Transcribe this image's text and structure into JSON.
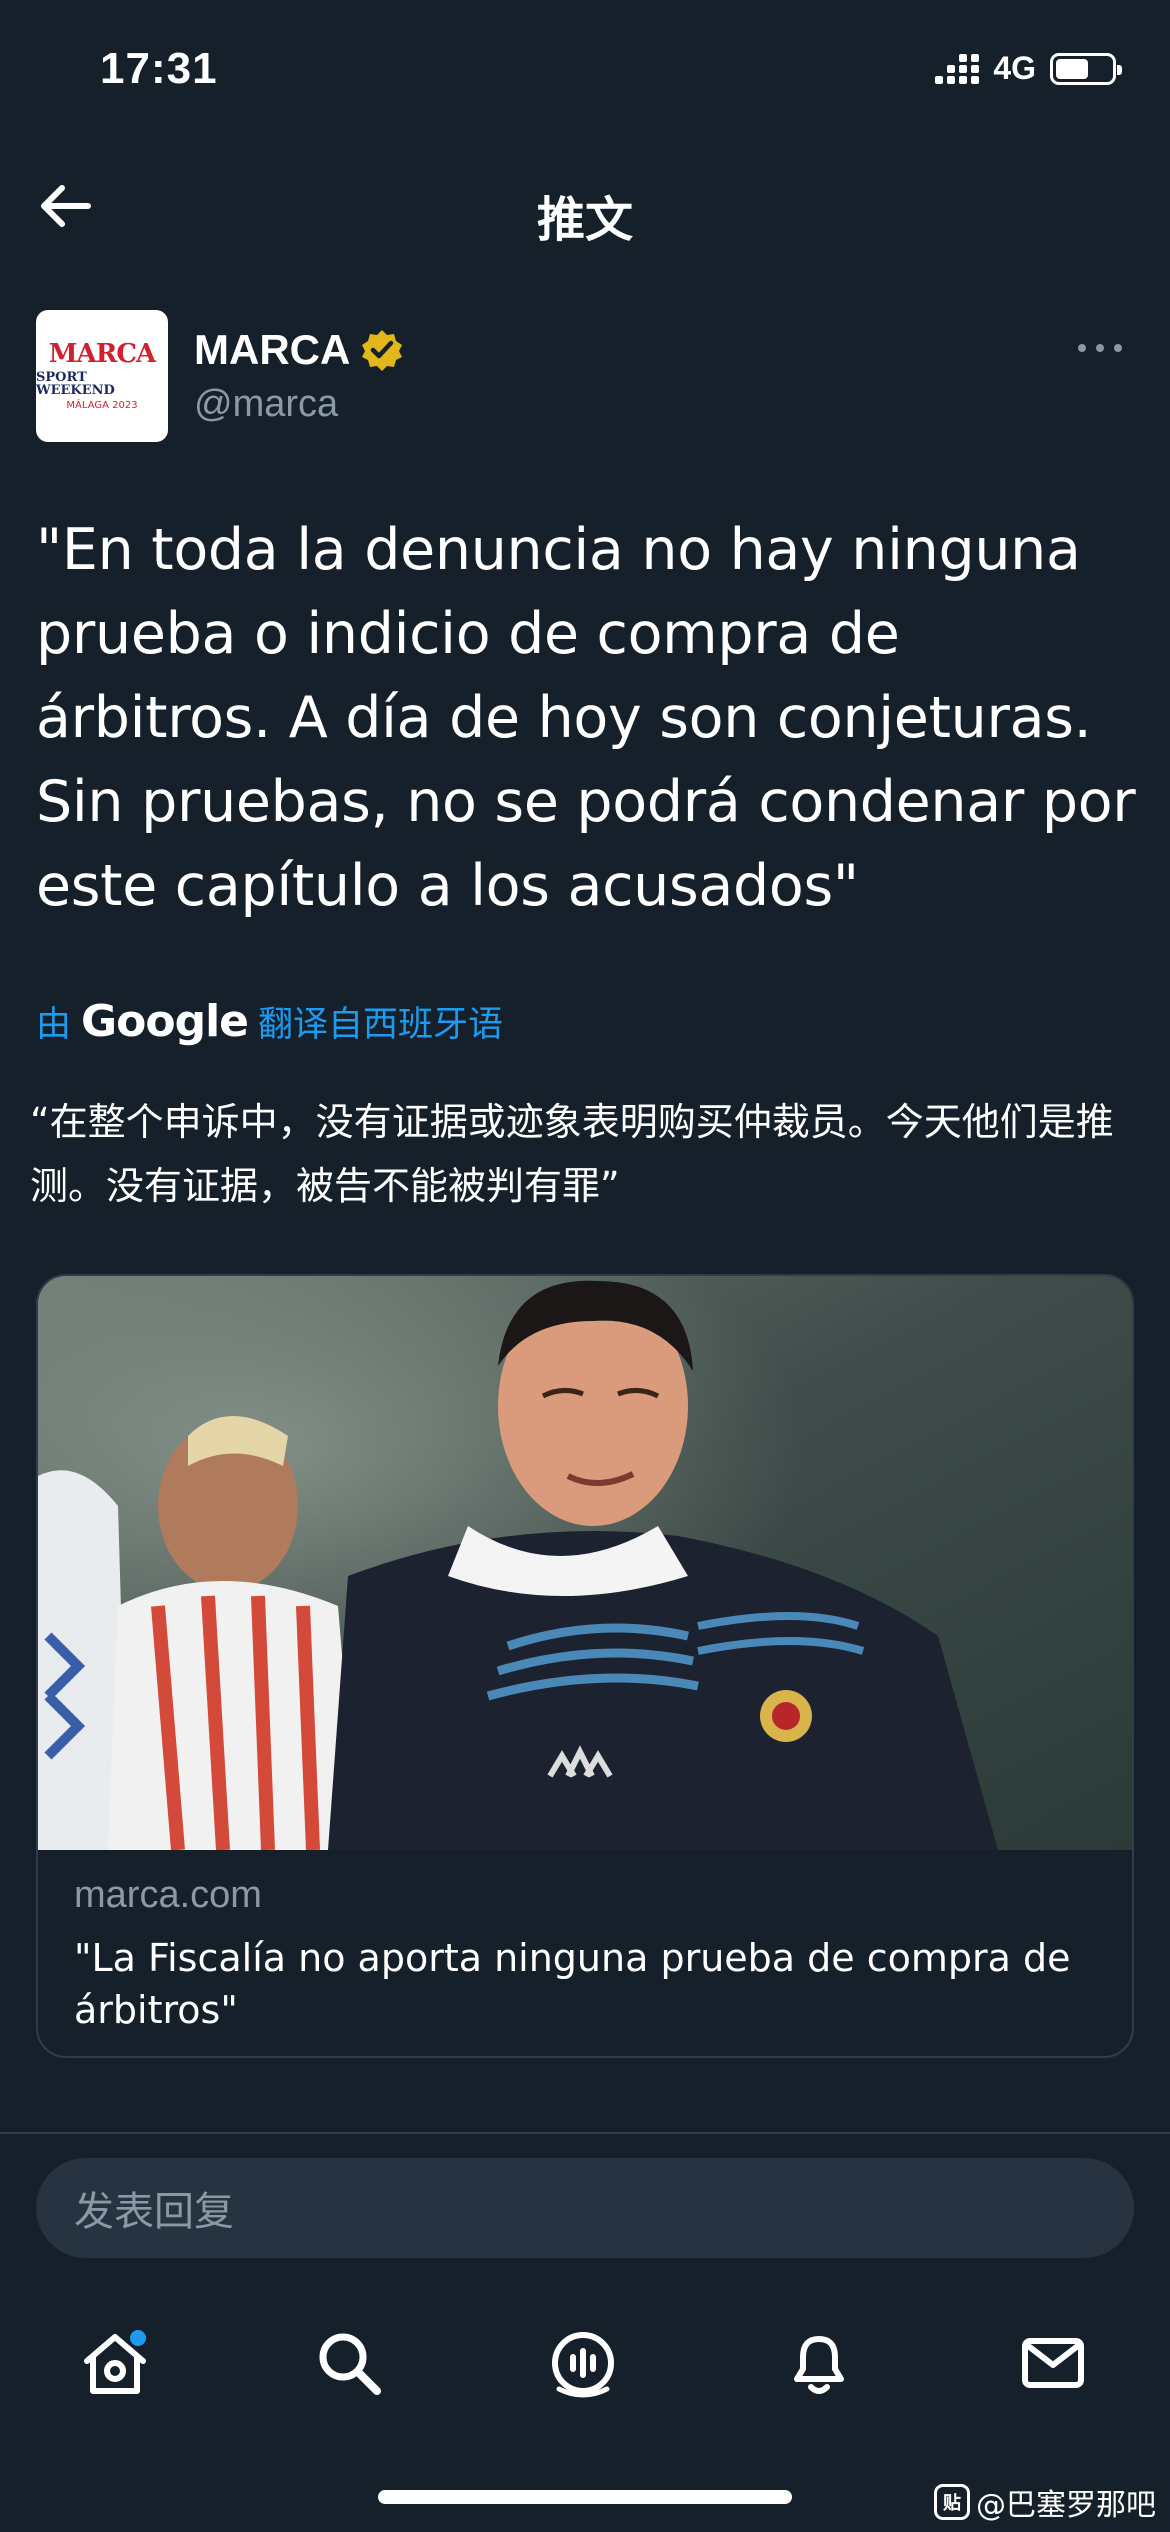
{
  "status_bar": {
    "time": "17:31",
    "network": "4G"
  },
  "header": {
    "title": "推文"
  },
  "tweet": {
    "author": {
      "name": "MARCA",
      "handle": "@marca",
      "avatar_lines": [
        "MARCA",
        "SPORT WEEKEND",
        "MÁLAGA 2023"
      ]
    },
    "text": "\"En toda la denuncia no hay ninguna prueba o indicio de compra de árbitros. A día de hoy son conjeturas. Sin pruebas, no se podrá condenar por este capítulo a los acusados\"",
    "translation": {
      "prefix": "由",
      "provider": "Google",
      "suffix": "翻译自西班牙语",
      "text": "“在整个申诉中，没有证据或迹象表明购买仲裁员。今天他们是推测。没有证据，被告不能被判有罪”"
    },
    "card": {
      "domain": "marca.com",
      "title": "\"La Fiscalía no aporta ninguna prueba de compra de árbitros\""
    }
  },
  "reply": {
    "placeholder": "发表回复"
  },
  "watermark": {
    "badge": "贴",
    "text": "@巴塞罗那吧"
  },
  "colors": {
    "background": "#15202b",
    "accent": "#1d9bf0",
    "muted": "#8b98a5",
    "verified": "#e2b719"
  }
}
